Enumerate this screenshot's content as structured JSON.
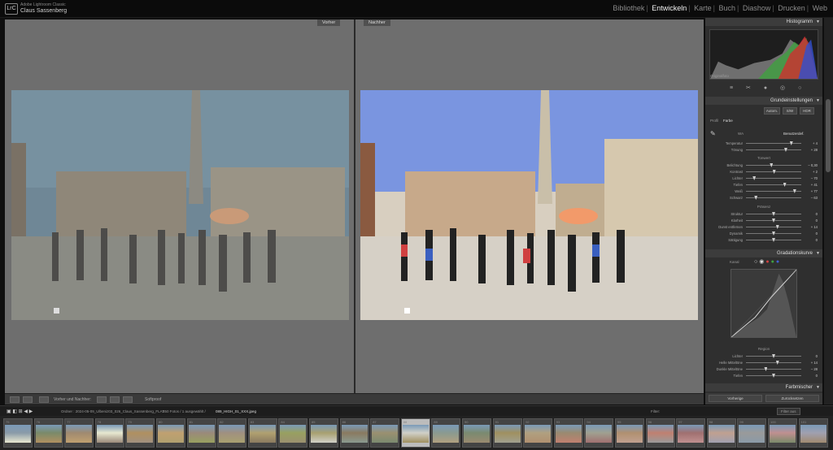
{
  "app": {
    "name": "Adobe Lightroom Classic",
    "user": "Claus Sassenberg",
    "logo": "LrC"
  },
  "modules": [
    "Bibliothek",
    "Entwickeln",
    "Karte",
    "Buch",
    "Diashow",
    "Drucken",
    "Web"
  ],
  "active_module": "Entwickeln",
  "compare": {
    "before_label": "Vorher",
    "after_label": "Nachher"
  },
  "toolbar": {
    "compare_label": "Vorher und Nachher:",
    "softproof_label": "Softproof"
  },
  "filmbar": {
    "folder_text": "Ordner : 2024-05-09_Ulbeniz03_026_Claus_Sassenberg_FLAT",
    "count_text": "350 Fotos / 1 ausgewählt /",
    "filename": "089_HIGH_01_XXX.jpeg",
    "filter_label": "Filter:",
    "filter_value": "Filter aus"
  },
  "right_panel": {
    "histogram_title": "Histogramm",
    "original_photo_label": "Originalfoto",
    "basic_title": "Grundeinstellungen",
    "auto_label": "Autom.",
    "sw_label": "S/W",
    "hdr_label": "HDR",
    "profile_label": "Profil",
    "profile_value": "Farbe",
    "wb_label": "WA",
    "wb_value": "Benutzerdef.",
    "tone_title": "Tonwert",
    "presence_title": "Präsenz",
    "curve_title": "Gradationskurve",
    "curve_channel": "Kanal",
    "region_title": "Region",
    "mixer_title": "Farbmischer",
    "prev_button": "Vorherige",
    "reset_button": "Zurücksetzen",
    "wb_sliders": [
      {
        "label": "Temperatur",
        "value": "+ 4",
        "pos": 0.82
      },
      {
        "label": "Tönung",
        "value": "+ 28",
        "pos": 0.72
      }
    ],
    "tone_sliders": [
      {
        "label": "Belichtung",
        "value": "– 0,30",
        "pos": 0.46
      },
      {
        "label": "Kontrast",
        "value": "+ 2",
        "pos": 0.51
      },
      {
        "label": "Lichter",
        "value": "– 70",
        "pos": 0.15
      },
      {
        "label": "Tiefen",
        "value": "+ 41",
        "pos": 0.7
      },
      {
        "label": "Weiß",
        "value": "+ 77",
        "pos": 0.88
      },
      {
        "label": "Schwarz",
        "value": "– 63",
        "pos": 0.18
      }
    ],
    "presence_sliders": [
      {
        "label": "Struktur",
        "value": "0",
        "pos": 0.5
      },
      {
        "label": "Klarheit",
        "value": "0",
        "pos": 0.5
      },
      {
        "label": "Dunst entfernen",
        "value": "+ 14",
        "pos": 0.57
      },
      {
        "label": "Dynamik",
        "value": "0",
        "pos": 0.5
      },
      {
        "label": "Sättigung",
        "value": "0",
        "pos": 0.5
      }
    ],
    "region_sliders": [
      {
        "label": "Lichter",
        "value": "0",
        "pos": 0.5
      },
      {
        "label": "Helle Mitteltöne",
        "value": "+ 14",
        "pos": 0.57
      },
      {
        "label": "Dunkle Mitteltöne",
        "value": "– 28",
        "pos": 0.36
      },
      {
        "label": "Tiefen",
        "value": "0",
        "pos": 0.5
      }
    ]
  },
  "filmstrip": {
    "numbers": [
      "75",
      "76",
      "77",
      "78",
      "79",
      "80",
      "81",
      "82",
      "83",
      "84",
      "85",
      "86",
      "87",
      "88",
      "89",
      "90",
      "91",
      "92",
      "93",
      "94",
      "95",
      "96",
      "97",
      "98",
      "99",
      "100",
      "101"
    ],
    "selected_index": 13
  },
  "colors": {
    "accent": "#f2f2f2",
    "panel_bg": "#2f2f2f",
    "sky_after": "#7a95e0",
    "sky_before": "#6f8a9a"
  }
}
